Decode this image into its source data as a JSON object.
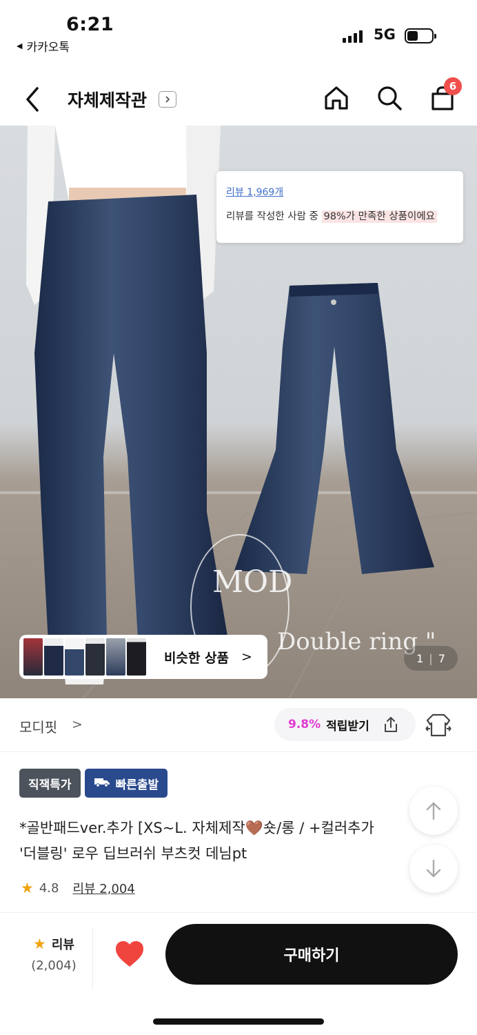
{
  "status_bar": {
    "time": "6:21",
    "back_app": "카카오톡",
    "network": "5G",
    "battery_level": 0.45
  },
  "nav": {
    "shop_title": "자체제작관",
    "cart_count": "6"
  },
  "hero": {
    "review_card": {
      "link": "리뷰 1,969개",
      "text_prefix": "리뷰를 작성한 사람 중",
      "highlight": "98%가 만족한 상품이에요"
    },
    "watermark_mark": "MOD",
    "watermark_text": "Double ring \"",
    "page_current": "1",
    "page_total": "7",
    "similar_label": "비슷한 상품",
    "similar_arrow": ">"
  },
  "brand": {
    "name": "모디핏",
    "arrow": ">",
    "point_pct": "9.8%",
    "point_label": "적립받기"
  },
  "product": {
    "badges": [
      "직잭특가",
      "빠른출발"
    ],
    "title_line1": "*골반패드ver.추가 [XS~L. 자체제작🤎숏/롱 / +컬러추가",
    "title_line2": "'더블링' 로우 딥브러쉬 부츠컷 데님pt",
    "rating": "4.8",
    "review_link": "리뷰 2,004"
  },
  "bottom_bar": {
    "review_label": "리뷰",
    "review_count": "(2,004)",
    "buy_label": "구매하기"
  },
  "colors": {
    "accent_pink": "#e03ad0",
    "badge_red": "#f0504d",
    "star": "#f2a20e",
    "heart": "#f0453f",
    "badge_blue": "#2a4a8e",
    "badge_gray": "#4c535c"
  },
  "icons": [
    "back-arrow-icon",
    "home-icon",
    "search-icon",
    "cart-icon",
    "share-icon",
    "fit-icon",
    "arrow-up-icon",
    "arrow-down-icon",
    "heart-icon",
    "star-icon",
    "truck-icon"
  ]
}
